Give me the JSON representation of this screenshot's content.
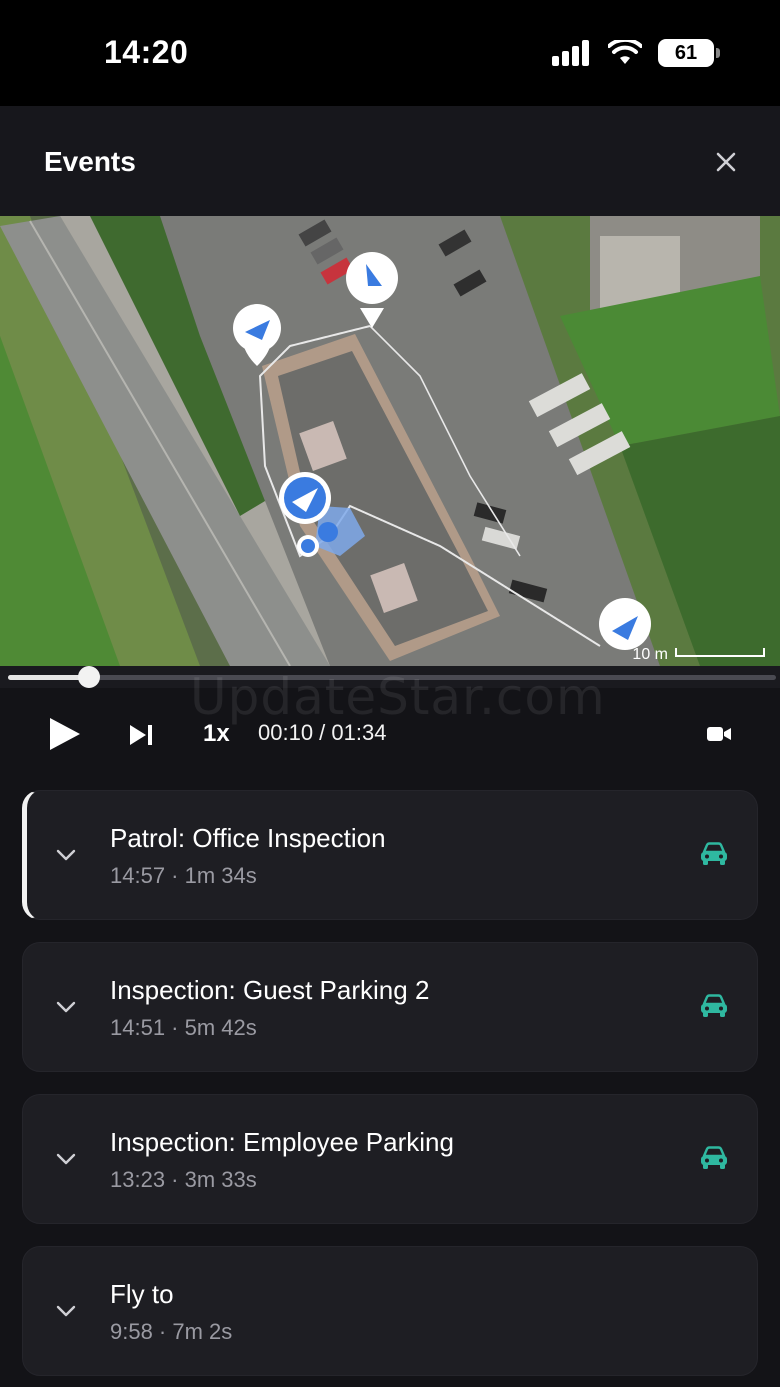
{
  "status_bar": {
    "time": "14:20",
    "battery": "61"
  },
  "header": {
    "title": "Events"
  },
  "map": {
    "scale_label": "10 m"
  },
  "playback": {
    "progress_fraction": 0.106,
    "speed": "1x",
    "time": "00:10 / 01:34",
    "watermark": "UpdateStar.com"
  },
  "events": [
    {
      "title": "Patrol: Office Inspection",
      "meta": "14:57 · 1m 34s",
      "icon": "car-icon",
      "active": true
    },
    {
      "title": "Inspection: Guest Parking 2",
      "meta": "14:51 · 5m 42s",
      "icon": "car-icon",
      "active": false
    },
    {
      "title": "Inspection: Employee Parking",
      "meta": "13:23 · 3m 33s",
      "icon": "car-icon",
      "active": false
    },
    {
      "title": "Fly to",
      "meta": "9:58 · 7m 2s",
      "icon": "",
      "active": false
    }
  ],
  "colors": {
    "accent": "#3a7be0",
    "car": "#2fb8a0",
    "background": "#131317"
  }
}
